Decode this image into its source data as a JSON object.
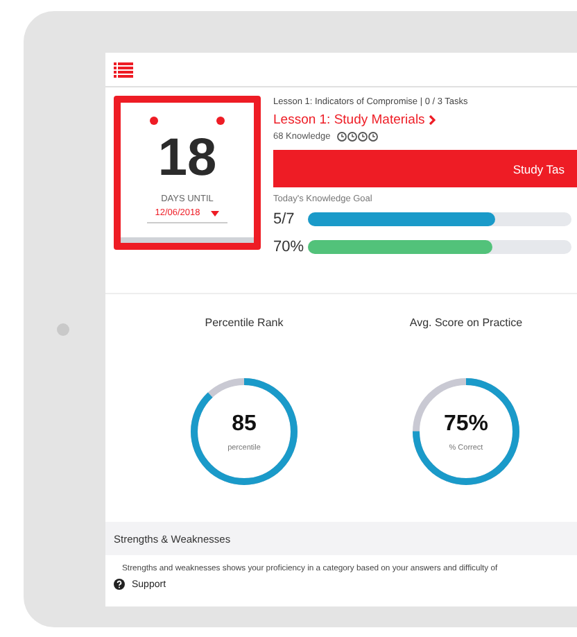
{
  "calendar": {
    "days": "18",
    "label": "DAYS UNTIL",
    "date": "12/06/2018"
  },
  "lesson": {
    "breadcrumb": "Lesson 1: Indicators of Compromise | 0 / 3 Tasks",
    "title": "Lesson 1: Study Materials",
    "knowledge": "68 Knowledge"
  },
  "study_button": {
    "label": "Study Tas"
  },
  "goal": {
    "label": "Today's Knowledge Goal",
    "bars": [
      {
        "reading": "5/7",
        "level": 0.71,
        "color": "#1a9ac9"
      },
      {
        "reading": "70%",
        "level": 0.7,
        "color": "#52c27a"
      }
    ]
  },
  "stats": [
    {
      "title": "Percentile Rank",
      "value": "85",
      "caption": "percentile",
      "level": 0.88
    },
    {
      "title": "Avg. Score on Practice",
      "value": "75%",
      "caption": "% Correct",
      "level": 0.75
    }
  ],
  "strengths": {
    "title": "Strengths & Weaknesses",
    "description": "Strengths and weaknesses shows your proficiency in a category based on your answers and difficulty of",
    "support": "Support"
  }
}
